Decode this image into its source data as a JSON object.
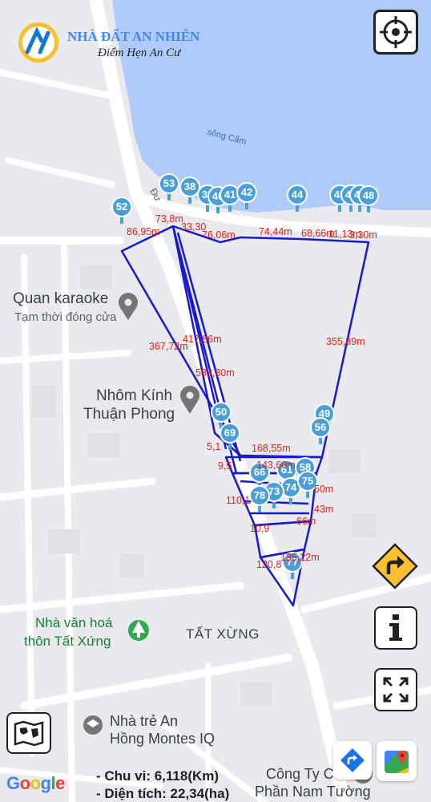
{
  "brand": {
    "name": "NHÀ ĐẤT AN NHIÊN",
    "slogan": "Điểm Hẹn An Cư"
  },
  "map": {
    "river_label": "sông Cấm",
    "road_label": "Đư",
    "places": [
      {
        "id": "karaoke",
        "lines": [
          "Quan karaoke",
          "Tạm thời đóng cửa"
        ]
      },
      {
        "id": "nhom-kinh",
        "lines": [
          "Nhôm Kính",
          "Thuận Phong"
        ]
      },
      {
        "id": "nha-van-hoa",
        "lines": [
          "Nhà văn hoá",
          "thôn Tất Xứng"
        ]
      },
      {
        "id": "tat-xung",
        "lines": [
          "TẤT XỪNG"
        ]
      },
      {
        "id": "nha-tre",
        "lines": [
          "Nhà trẻ An",
          "Hồng Montes IQ"
        ]
      },
      {
        "id": "cong-ty",
        "lines": [
          "Công Ty Cổ",
          "Phần Nam Tường"
        ]
      }
    ],
    "google_logo": "Google"
  },
  "markers": [
    "52",
    "53",
    "38",
    "39",
    "40",
    "41",
    "42",
    "44",
    "45",
    "46",
    "47",
    "48",
    "49",
    "50",
    "56",
    "69",
    "66",
    "61",
    "58",
    "74",
    "75",
    "73",
    "78",
    "77"
  ],
  "dimensions": [
    "86,95m",
    "73,8m",
    "33,30",
    "76,06m",
    "74,44m",
    "68,66m",
    "11,13m",
    "3,30m",
    "367,72m",
    "417,86m",
    "583,80m",
    "355,89m",
    "5,1",
    "168,55m",
    "9,5",
    "143,60m",
    "110,1",
    "50m",
    "43m",
    "66m",
    "10,9",
    "135,22m",
    "120,8"
  ],
  "summary": {
    "perimeter": "- Chu vi: 6,118(Km)",
    "area": "- Diện tích: 22,34(ha)"
  },
  "controls": {
    "locate": "crosshair-icon",
    "direction": "turn-right-icon",
    "info": "info-icon",
    "fullscreen": "fullscreen-icon",
    "layers": "map-layers-icon",
    "directions_app": "directions-icon",
    "google_maps": "google-maps-icon"
  },
  "colors": {
    "water": "#aecbfa",
    "boundary": "#1a1acd",
    "marker": "#4a9fd8",
    "label": "#e0201b",
    "direction_button": "#fbc02d"
  }
}
